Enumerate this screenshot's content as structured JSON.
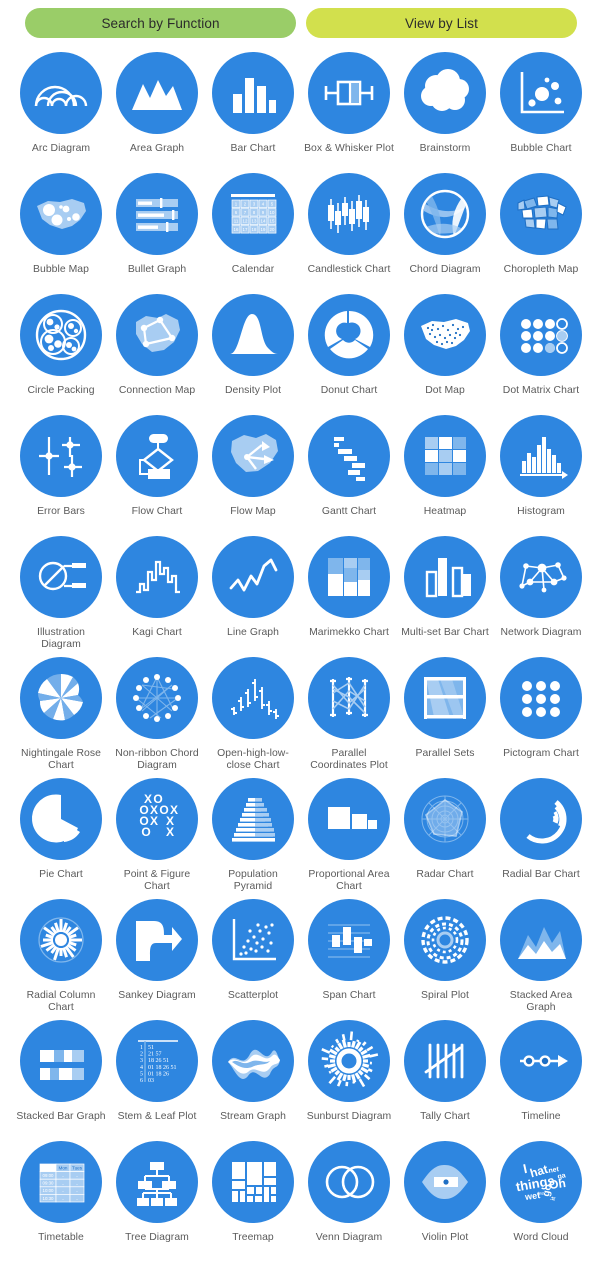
{
  "header": {
    "buttons": [
      {
        "label": "Search by Function",
        "color": "#9ACD68"
      },
      {
        "label": "View by List",
        "color": "#D2E04D"
      }
    ]
  },
  "theme": {
    "circle_blue": "#2e86e0",
    "icon_white": "#ffffff",
    "icon_tint_light": "#a8cdf2",
    "icon_tint_mid": "#7fb6ec",
    "label_gray": "#5b5b5b",
    "page_bg": "#ffffff"
  },
  "grid": {
    "columns": 6,
    "rows": 10,
    "items": [
      {
        "label": "Arc Diagram",
        "icon": "arc-diagram-icon"
      },
      {
        "label": "Area Graph",
        "icon": "area-graph-icon"
      },
      {
        "label": "Bar Chart",
        "icon": "bar-chart-icon"
      },
      {
        "label": "Box & Whisker Plot",
        "icon": "box-whisker-plot-icon"
      },
      {
        "label": "Brainstorm",
        "icon": "brainstorm-icon"
      },
      {
        "label": "Bubble Chart",
        "icon": "bubble-chart-icon"
      },
      {
        "label": "Bubble Map",
        "icon": "bubble-map-icon"
      },
      {
        "label": "Bullet Graph",
        "icon": "bullet-graph-icon"
      },
      {
        "label": "Calendar",
        "icon": "calendar-icon"
      },
      {
        "label": "Candlestick Chart",
        "icon": "candlestick-chart-icon"
      },
      {
        "label": "Chord Diagram",
        "icon": "chord-diagram-icon"
      },
      {
        "label": "Choropleth Map",
        "icon": "choropleth-map-icon"
      },
      {
        "label": "Circle Packing",
        "icon": "circle-packing-icon"
      },
      {
        "label": "Connection Map",
        "icon": "connection-map-icon"
      },
      {
        "label": "Density Plot",
        "icon": "density-plot-icon"
      },
      {
        "label": "Donut Chart",
        "icon": "donut-chart-icon"
      },
      {
        "label": "Dot Map",
        "icon": "dot-map-icon"
      },
      {
        "label": "Dot Matrix Chart",
        "icon": "dot-matrix-chart-icon"
      },
      {
        "label": "Error Bars",
        "icon": "error-bars-icon"
      },
      {
        "label": "Flow Chart",
        "icon": "flow-chart-icon"
      },
      {
        "label": "Flow Map",
        "icon": "flow-map-icon"
      },
      {
        "label": "Gantt Chart",
        "icon": "gantt-chart-icon"
      },
      {
        "label": "Heatmap",
        "icon": "heatmap-icon"
      },
      {
        "label": "Histogram",
        "icon": "histogram-icon"
      },
      {
        "label": "Illustration Diagram",
        "icon": "illustration-diagram-icon"
      },
      {
        "label": "Kagi Chart",
        "icon": "kagi-chart-icon"
      },
      {
        "label": "Line Graph",
        "icon": "line-graph-icon"
      },
      {
        "label": "Marimekko Chart",
        "icon": "marimekko-chart-icon"
      },
      {
        "label": "Multi-set Bar Chart",
        "icon": "multi-set-bar-chart-icon"
      },
      {
        "label": "Network Diagram",
        "icon": "network-diagram-icon"
      },
      {
        "label": "Nightingale Rose Chart",
        "icon": "nightingale-rose-chart-icon"
      },
      {
        "label": "Non-ribbon Chord Diagram",
        "icon": "non-ribbon-chord-diagram-icon"
      },
      {
        "label": "Open-high-low-close Chart",
        "icon": "open-high-low-close-chart-icon"
      },
      {
        "label": "Parallel Coordinates Plot",
        "icon": "parallel-coordinates-plot-icon"
      },
      {
        "label": "Parallel Sets",
        "icon": "parallel-sets-icon"
      },
      {
        "label": "Pictogram Chart",
        "icon": "pictogram-chart-icon"
      },
      {
        "label": "Pie Chart",
        "icon": "pie-chart-icon"
      },
      {
        "label": "Point & Figure Chart",
        "icon": "point-figure-chart-icon"
      },
      {
        "label": "Population Pyramid",
        "icon": "population-pyramid-icon"
      },
      {
        "label": "Proportional Area Chart",
        "icon": "proportional-area-chart-icon"
      },
      {
        "label": "Radar Chart",
        "icon": "radar-chart-icon"
      },
      {
        "label": "Radial Bar Chart",
        "icon": "radial-bar-chart-icon"
      },
      {
        "label": "Radial Column Chart",
        "icon": "radial-column-chart-icon"
      },
      {
        "label": "Sankey Diagram",
        "icon": "sankey-diagram-icon"
      },
      {
        "label": "Scatterplot",
        "icon": "scatterplot-icon"
      },
      {
        "label": "Span Chart",
        "icon": "span-chart-icon"
      },
      {
        "label": "Spiral Plot",
        "icon": "spiral-plot-icon"
      },
      {
        "label": "Stacked Area Graph",
        "icon": "stacked-area-graph-icon"
      },
      {
        "label": "Stacked Bar Graph",
        "icon": "stacked-bar-graph-icon"
      },
      {
        "label": "Stem & Leaf Plot",
        "icon": "stem-leaf-plot-icon"
      },
      {
        "label": "Stream Graph",
        "icon": "stream-graph-icon"
      },
      {
        "label": "Sunburst Diagram",
        "icon": "sunburst-diagram-icon"
      },
      {
        "label": "Tally Chart",
        "icon": "tally-chart-icon"
      },
      {
        "label": "Timeline",
        "icon": "timeline-icon"
      },
      {
        "label": "Timetable",
        "icon": "timetable-icon"
      },
      {
        "label": "Tree Diagram",
        "icon": "tree-diagram-icon"
      },
      {
        "label": "Treemap",
        "icon": "treemap-icon"
      },
      {
        "label": "Venn Diagram",
        "icon": "venn-diagram-icon"
      },
      {
        "label": "Violin Plot",
        "icon": "violin-plot-icon"
      },
      {
        "label": "Word Cloud",
        "icon": "word-cloud-icon"
      }
    ]
  },
  "icon_text": {
    "stem_leaf_rows": [
      {
        "stem": "1",
        "leaves": "51"
      },
      {
        "stem": "2",
        "leaves": "21 57"
      },
      {
        "stem": "3",
        "leaves": "18 26 51"
      },
      {
        "stem": "4",
        "leaves": "01 18 26 51"
      },
      {
        "stem": "5",
        "leaves": "01 18 26"
      },
      {
        "stem": "6",
        "leaves": "03"
      }
    ],
    "timetable_columns": [
      "",
      "Mon",
      "Tues"
    ],
    "timetable_rows": [
      "09:00",
      "09:30",
      "10:00",
      "10:30"
    ],
    "calendar_numbers": [
      "1",
      "2",
      "3",
      "4",
      "5",
      "6",
      "7",
      "8",
      "9",
      "10",
      "11",
      "12",
      "13",
      "14",
      "15",
      "16",
      "17",
      "18",
      "19",
      "20"
    ],
    "point_figure_marks": [
      "X",
      "O",
      "",
      "O",
      "X",
      "O",
      "X",
      "O",
      "X",
      "",
      "X",
      "O",
      "",
      "X"
    ],
    "word_cloud_words": [
      "I",
      "hat",
      "net",
      "ga",
      "things",
      "go",
      "Oh",
      "the",
      "wet",
      "it"
    ]
  }
}
